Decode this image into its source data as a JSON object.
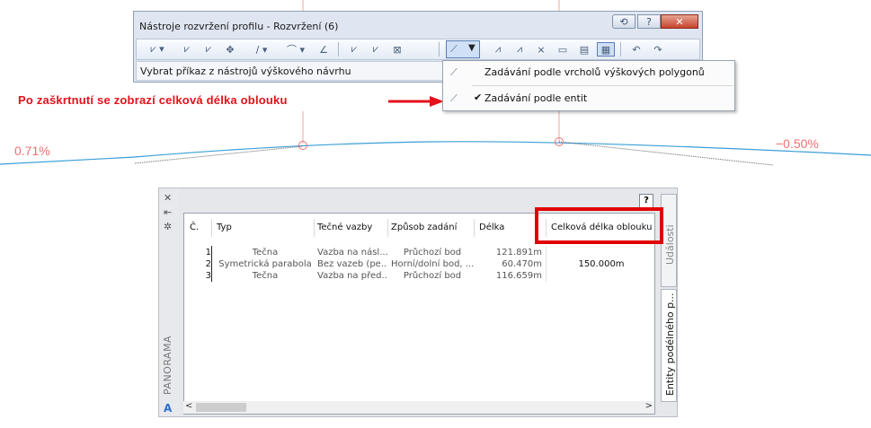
{
  "colors": {
    "accent_red": "#e4101a",
    "curve_blue": "#3a9fd8",
    "grade_pink": "#f07070",
    "highlight_box": "#e00000"
  },
  "toolbar": {
    "title": "Nástroje rozvržení profilu - Rozvržení (6)",
    "status": "Vybrat příkaz z nástrojů výškového návrhu",
    "controls": {
      "help": "?",
      "close": "✕"
    }
  },
  "dropdown": {
    "items": [
      {
        "label": "Zadávání podle vrcholů výškových polygonů",
        "checked": false
      },
      {
        "label": "Zadávání podle entit",
        "checked": true,
        "check_mark": "✔"
      }
    ]
  },
  "annotation": {
    "text": "Po zaškrtnutí se zobrazí celková délka oblouku"
  },
  "profile": {
    "grade_left": "0.71%",
    "grade_right": "−0.50%"
  },
  "panorama": {
    "title": "PANORAMA",
    "help": "?",
    "tabs": [
      "Události",
      "Entity podélného p..."
    ],
    "columns": [
      "Č.",
      "Typ",
      "Tečné vazby",
      "Způsob zadání",
      "Délka",
      "Celková délka oblouku"
    ],
    "rows": [
      [
        "1",
        "Tečna",
        "Vazba na násl...",
        "Průchozí bod",
        "121.891m",
        ""
      ],
      [
        "2",
        "Symetrická parabola",
        "Bez vazeb (pe...",
        "Horní/dolní bod, ...",
        "60.470m",
        "150.000m"
      ],
      [
        "3",
        "Tečna",
        "Vazba na před...",
        "Průchozí bod",
        "116.659m",
        ""
      ]
    ],
    "scroll_left": "<",
    "scroll_right": ">"
  }
}
